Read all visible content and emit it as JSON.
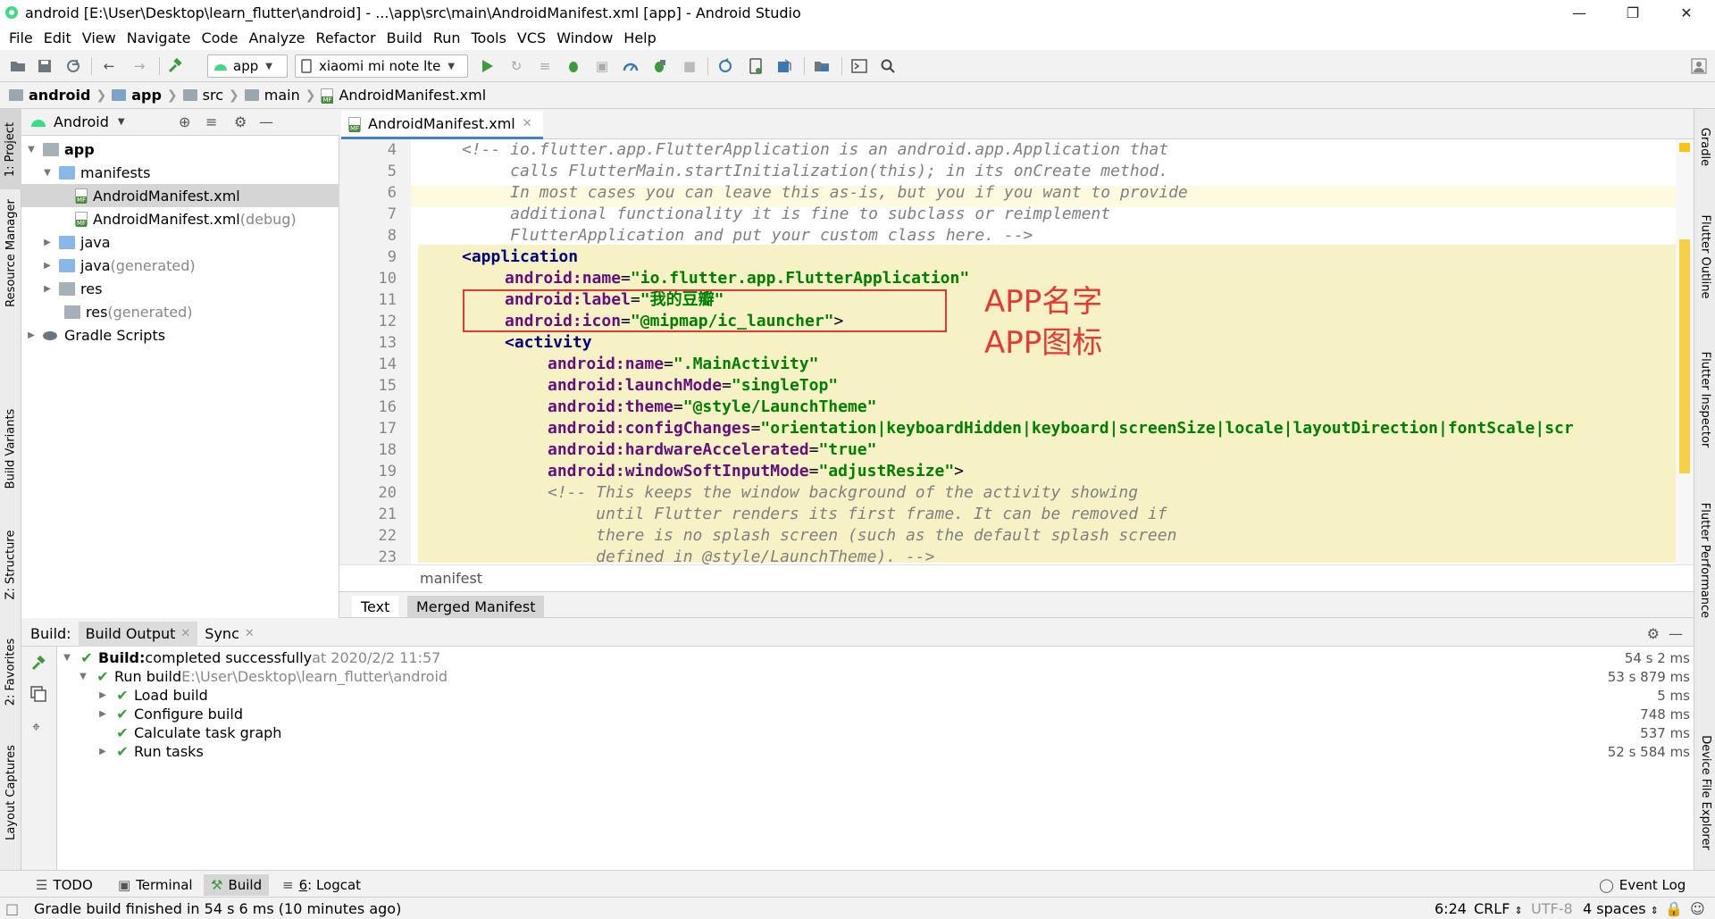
{
  "window": {
    "title": "android [E:\\User\\Desktop\\learn_flutter\\android] - ...\\app\\src\\main\\AndroidManifest.xml [app] - Android Studio"
  },
  "menu": [
    "File",
    "Edit",
    "View",
    "Navigate",
    "Code",
    "Analyze",
    "Refactor",
    "Build",
    "Run",
    "Tools",
    "VCS",
    "Window",
    "Help"
  ],
  "toolbar": {
    "run_config": "app",
    "device": "xiaomi mi note lte"
  },
  "breadcrumb": [
    "android",
    "app",
    "src",
    "main",
    "AndroidManifest.xml"
  ],
  "left_stripe": [
    "1: Project",
    "Resource Manager",
    "Build Variants",
    "Z: Structure",
    "2: Favorites",
    "Layout Captures"
  ],
  "right_stripe": [
    "Gradle",
    "Flutter Outline",
    "Flutter Inspector",
    "Flutter Performance",
    "Device File Explorer"
  ],
  "project": {
    "view": "Android",
    "tree": [
      {
        "label": "app",
        "extra": ""
      },
      {
        "label": "manifests",
        "extra": ""
      },
      {
        "label": "AndroidManifest.xml",
        "extra": ""
      },
      {
        "label": "AndroidManifest.xml",
        "extra": " (debug)"
      },
      {
        "label": "java",
        "extra": ""
      },
      {
        "label": "java",
        "extra": " (generated)"
      },
      {
        "label": "res",
        "extra": ""
      },
      {
        "label": "res",
        "extra": " (generated)"
      },
      {
        "label": "Gradle Scripts",
        "extra": ""
      }
    ]
  },
  "editor": {
    "tab": "AndroidManifest.xml",
    "line_numbers": [
      "4",
      "5",
      "6",
      "7",
      "8",
      "9",
      "10",
      "11",
      "12",
      "13",
      "14",
      "15",
      "16",
      "17",
      "18",
      "19",
      "20",
      "21",
      "22",
      "23"
    ],
    "lines": {
      "l4": "<!-- io.flutter.app.FlutterApplication is an android.app.Application that",
      "l5": "     calls FlutterMain.startInitialization(this); in its onCreate method.",
      "l6": "     In most cases you can leave this as-is, but you if you want to provide",
      "l7": "     additional functionality it is fine to subclass or reimplement",
      "l8": "     FlutterApplication and put your custom class here. -->",
      "l9": "<application",
      "l10_attr": "android:name",
      "l10_val": "\"io.flutter.app.FlutterApplication\"",
      "l11_attr": "android:label",
      "l11_val": "\"我的豆瓣\"",
      "l12_attr": "android:icon",
      "l12_val": "\"@mipmap/ic_launcher\"",
      "l13": "<activity",
      "l14_attr": "android:name",
      "l14_val": "\".MainActivity\"",
      "l15_attr": "android:launchMode",
      "l15_val": "\"singleTop\"",
      "l16_attr": "android:theme",
      "l16_val": "\"@style/LaunchTheme\"",
      "l17_attr": "android:configChanges",
      "l17_val": "\"orientation|keyboardHidden|keyboard|screenSize|locale|layoutDirection|fontScale|scr",
      "l18_attr": "android:hardwareAccelerated",
      "l18_val": "\"true\"",
      "l19_attr": "android:windowSoftInputMode",
      "l19_val": "\"adjustResize\"",
      "l20": "<!-- This keeps the window background of the activity showing",
      "l21": "     until Flutter renders its first frame. It can be removed if",
      "l22": "     there is no splash screen (such as the default splash screen",
      "l23": "     defined in @style/LaunchTheme). -->"
    },
    "annotations": {
      "app_name": "APP名字",
      "app_icon": "APP图标"
    },
    "footer": "manifest",
    "bottom_tabs": [
      "Text",
      "Merged Manifest"
    ]
  },
  "build": {
    "label": "Build:",
    "tabs": [
      "Build Output",
      "Sync"
    ],
    "rows": [
      {
        "bold": "Build:",
        "text": " completed successfully",
        "muted": " at 2020/2/2 11:57",
        "time": "54 s 2 ms"
      },
      {
        "bold": "",
        "text": "Run build ",
        "muted": "E:\\User\\Desktop\\learn_flutter\\android",
        "time": "53 s 879 ms"
      },
      {
        "bold": "",
        "text": "Load build",
        "muted": "",
        "time": "5 ms"
      },
      {
        "bold": "",
        "text": "Configure build",
        "muted": "",
        "time": "748 ms"
      },
      {
        "bold": "",
        "text": "Calculate task graph",
        "muted": "",
        "time": "537 ms"
      },
      {
        "bold": "",
        "text": "Run tasks",
        "muted": "",
        "time": "52 s 584 ms"
      }
    ]
  },
  "bottom_tabs": {
    "todo": "TODO",
    "terminal": "Terminal",
    "build": "Build",
    "logcat_key": "6",
    "logcat": ": Logcat",
    "event_log": "Event Log"
  },
  "status": {
    "message": "Gradle build finished in 54 s 6 ms (10 minutes ago)",
    "position": "6:24",
    "line_sep": "CRLF",
    "encoding": "UTF-8",
    "indent": "4 spaces"
  }
}
